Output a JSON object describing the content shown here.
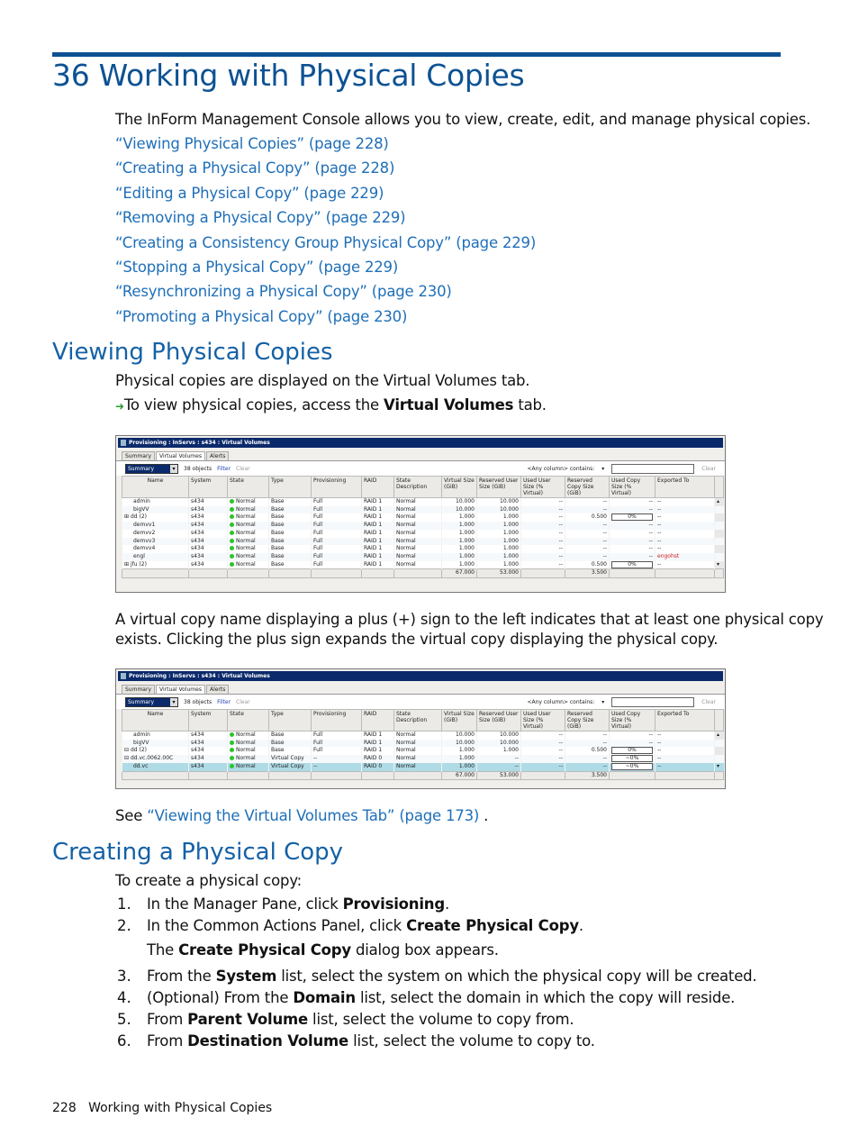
{
  "chapter_title": "36 Working with Physical Copies",
  "intro": "The InForm Management Console allows you to view, create, edit, and manage physical copies.",
  "toc_links": [
    "“Viewing Physical Copies” (page 228)",
    "“Creating a Physical Copy” (page 228)",
    "“Editing a Physical Copy” (page 229)",
    "“Removing a Physical Copy” (page 229)",
    "“Creating a Consistency Group Physical Copy” (page 229)",
    "“Stopping a Physical Copy” (page 229)",
    "“Resynchronizing a Physical Copy” (page 230)",
    "“Promoting a Physical Copy” (page 230)"
  ],
  "viewing": {
    "heading": "Viewing Physical Copies",
    "p1": "Physical copies are displayed on the Virtual Volumes tab.",
    "step_pre": "To view physical copies, access the ",
    "step_bold": "Virtual Volumes",
    "step_post": " tab.",
    "p2_line1": "A virtual copy name displaying a plus (+) sign to the left indicates that at least one physical copy",
    "p2_line2": "exists. Clicking the plus sign expands the virtual copy displaying the physical copy.",
    "see_pre": "See ",
    "see_link": "“Viewing the Virtual Volumes Tab” (page 173)",
    "see_post": " ."
  },
  "screenshot": {
    "title": "Provisioning : InServs : s434 : Virtual Volumes",
    "tabs": [
      "Summary",
      "Virtual Volumes",
      "Alerts"
    ],
    "view_select": "Summary",
    "object_count": "38 objects",
    "filter": "Filter",
    "clear": "Clear",
    "any_column": "<Any column> contains:",
    "search_clear": "Clear",
    "columns": [
      "Name",
      "System",
      "State",
      "Type",
      "Provisioning",
      "RAID",
      "State Description",
      "Virtual Size (GiB)",
      "Reserved User Size (GiB)",
      "Used User Size (% Virtual)",
      "Reserved Copy Size (GiB)",
      "Used Copy Size (% Virtual)",
      "Exported To"
    ],
    "status_color": "#2ac42a",
    "highlight_color": "#aedbe6"
  },
  "grid1": {
    "rows": [
      {
        "exp": "",
        "name": "admin",
        "sys": "s434",
        "state": "Normal",
        "type": "Base",
        "prov": "Full",
        "raid": "RAID 1",
        "desc": "Normal",
        "vs": "10.000",
        "ru": "10.000",
        "uu": "--",
        "rc": "--",
        "uc": "--",
        "exp_to": "--"
      },
      {
        "exp": "",
        "name": "bigVV",
        "sys": "s434",
        "state": "Normal",
        "type": "Base",
        "prov": "Full",
        "raid": "RAID 1",
        "desc": "Normal",
        "vs": "10.000",
        "ru": "10.000",
        "uu": "--",
        "rc": "--",
        "uc": "--",
        "exp_to": "--"
      },
      {
        "exp": "⊞",
        "name": "dd  (2)",
        "sys": "s434",
        "state": "Normal",
        "type": "Base",
        "prov": "Full",
        "raid": "RAID 1",
        "desc": "Normal",
        "vs": "1.000",
        "ru": "1.000",
        "uu": "--",
        "rc": "0.500",
        "uc": "0%",
        "exp_to": "--"
      },
      {
        "exp": "",
        "name": "demvv1",
        "sys": "s434",
        "state": "Normal",
        "type": "Base",
        "prov": "Full",
        "raid": "RAID 1",
        "desc": "Normal",
        "vs": "1.000",
        "ru": "1.000",
        "uu": "--",
        "rc": "--",
        "uc": "--",
        "exp_to": "--"
      },
      {
        "exp": "",
        "name": "demvv2",
        "sys": "s434",
        "state": "Normal",
        "type": "Base",
        "prov": "Full",
        "raid": "RAID 1",
        "desc": "Normal",
        "vs": "1.000",
        "ru": "1.000",
        "uu": "--",
        "rc": "--",
        "uc": "--",
        "exp_to": "--"
      },
      {
        "exp": "",
        "name": "demvv3",
        "sys": "s434",
        "state": "Normal",
        "type": "Base",
        "prov": "Full",
        "raid": "RAID 1",
        "desc": "Normal",
        "vs": "1.000",
        "ru": "1.000",
        "uu": "--",
        "rc": "--",
        "uc": "--",
        "exp_to": "--"
      },
      {
        "exp": "",
        "name": "demvv4",
        "sys": "s434",
        "state": "Normal",
        "type": "Base",
        "prov": "Full",
        "raid": "RAID 1",
        "desc": "Normal",
        "vs": "1.000",
        "ru": "1.000",
        "uu": "--",
        "rc": "--",
        "uc": "--",
        "exp_to": "--"
      },
      {
        "exp": "",
        "name": "engl",
        "sys": "s434",
        "state": "Normal",
        "type": "Base",
        "prov": "Full",
        "raid": "RAID 1",
        "desc": "Normal",
        "vs": "1.000",
        "ru": "1.000",
        "uu": "--",
        "rc": "--",
        "uc": "--",
        "exp_to": "engohst"
      },
      {
        "exp": "⊞",
        "name": "jfu  (2)",
        "sys": "s434",
        "state": "Normal",
        "type": "Base",
        "prov": "Full",
        "raid": "RAID 1",
        "desc": "Normal",
        "vs": "1.000",
        "ru": "1.000",
        "uu": "--",
        "rc": "0.500",
        "uc": "0%",
        "exp_to": "--"
      }
    ],
    "totals": {
      "vs": "67.000",
      "ru": "53.000",
      "rc": "3.500"
    }
  },
  "grid2": {
    "rows": [
      {
        "exp": "",
        "name": "admin",
        "sys": "s434",
        "state": "Normal",
        "type": "Base",
        "prov": "Full",
        "raid": "RAID 1",
        "desc": "Normal",
        "vs": "10.000",
        "ru": "10.000",
        "uu": "--",
        "rc": "--",
        "uc": "--",
        "exp_to": "--"
      },
      {
        "exp": "",
        "name": "bigVV",
        "sys": "s434",
        "state": "Normal",
        "type": "Base",
        "prov": "Full",
        "raid": "RAID 1",
        "desc": "Normal",
        "vs": "10.000",
        "ru": "10.000",
        "uu": "--",
        "rc": "--",
        "uc": "--",
        "exp_to": "--"
      },
      {
        "exp": "⊟",
        "name": "dd  (2)",
        "sys": "s434",
        "state": "Normal",
        "type": "Base",
        "prov": "Full",
        "raid": "RAID 1",
        "desc": "Normal",
        "vs": "1.000",
        "ru": "1.000",
        "uu": "--",
        "rc": "0.500",
        "uc": "0%",
        "exp_to": "--"
      },
      {
        "exp": "  ⊟",
        "name": "dd.vc.0062.00C",
        "sys": "s434",
        "state": "Normal",
        "type": "Virtual Copy",
        "prov": "--",
        "raid": "RAID 0",
        "desc": "Normal",
        "vs": "1.000",
        "ru": "--",
        "uu": "--",
        "rc": "--",
        "uc": "~0%",
        "exp_to": "--"
      },
      {
        "exp": "",
        "name": "       dd.vc",
        "sys": "s434",
        "state": "Normal",
        "type": "Virtual Copy",
        "prov": "--",
        "raid": "RAID 0",
        "desc": "Normal",
        "vs": "1.000",
        "ru": "--",
        "uu": "--",
        "rc": "--",
        "uc": "~0%",
        "exp_to": "--",
        "hl": true
      }
    ],
    "totals": {
      "vs": "67.000",
      "ru": "53.000",
      "rc": "3.500"
    }
  },
  "creating": {
    "heading": "Creating a Physical Copy",
    "intro": "To create a physical copy:",
    "steps": [
      {
        "n": "1.",
        "pre": "In the Manager Pane, click ",
        "bold": "Provisioning",
        "post": "."
      },
      {
        "n": "2.",
        "pre": "In the Common Actions Panel, click ",
        "bold": "Create Physical Copy",
        "post": "."
      },
      {
        "n": "3.",
        "pre": "From the ",
        "bold": "System",
        "post": " list, select the system on which the physical copy will be created."
      },
      {
        "n": "4.",
        "pre": "(Optional) From the ",
        "bold": "Domain",
        "post": " list, select the domain in which the copy will reside."
      },
      {
        "n": "5.",
        "pre": "From ",
        "bold": "Parent Volume",
        "post": " list, select the volume to copy from."
      },
      {
        "n": "6.",
        "pre": "From ",
        "bold": "Destination Volume",
        "post": " list, select the volume to copy to."
      }
    ],
    "result_pre": "The ",
    "result_bold": "Create Physical Copy",
    "result_post": " dialog box appears."
  },
  "footer": {
    "page": "228",
    "title": "Working with Physical Copies"
  }
}
